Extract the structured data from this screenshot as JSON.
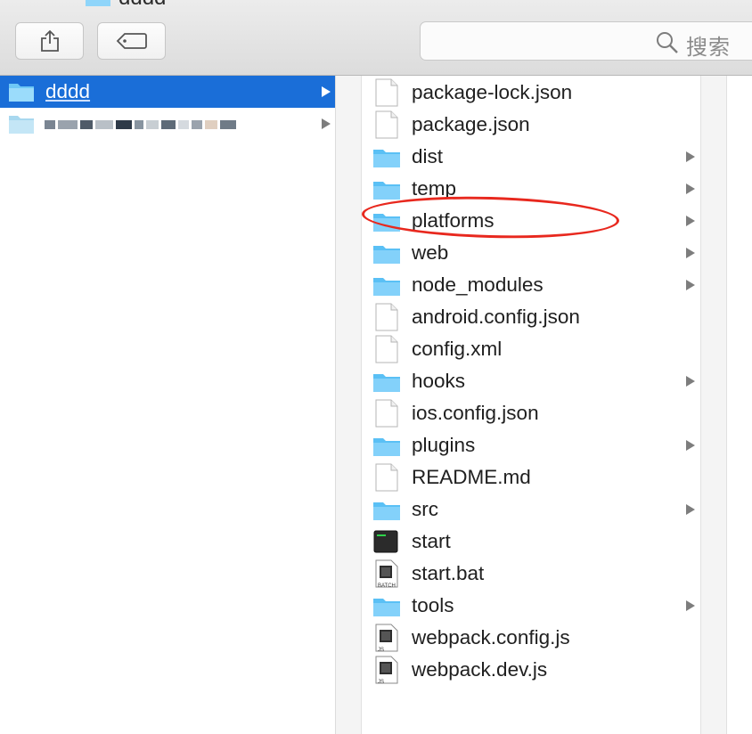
{
  "window": {
    "title": "dddd"
  },
  "toolbar": {
    "share_icon": "share-icon",
    "tag_icon": "tag-icon",
    "search": {
      "placeholder": "搜索",
      "icon": "magnifier-icon"
    }
  },
  "sidebar_column": {
    "items": [
      {
        "label": "dddd",
        "type": "folder",
        "selected": true
      },
      {
        "label": "",
        "type": "folder",
        "selected": false,
        "redacted": true
      }
    ]
  },
  "file_column": {
    "items": [
      {
        "label": "package-lock.json",
        "type": "file"
      },
      {
        "label": "package.json",
        "type": "file"
      },
      {
        "label": "dist",
        "type": "folder"
      },
      {
        "label": "temp",
        "type": "folder"
      },
      {
        "label": "platforms",
        "type": "folder",
        "highlighted": true
      },
      {
        "label": "web",
        "type": "folder"
      },
      {
        "label": "node_modules",
        "type": "folder"
      },
      {
        "label": "android.config.json",
        "type": "file"
      },
      {
        "label": "config.xml",
        "type": "file"
      },
      {
        "label": "hooks",
        "type": "folder"
      },
      {
        "label": "ios.config.json",
        "type": "file"
      },
      {
        "label": "plugins",
        "type": "folder"
      },
      {
        "label": "README.md",
        "type": "file"
      },
      {
        "label": "src",
        "type": "folder"
      },
      {
        "label": "start",
        "type": "exec"
      },
      {
        "label": "start.bat",
        "type": "batch",
        "badge": "BATCH"
      },
      {
        "label": "tools",
        "type": "folder"
      },
      {
        "label": "webpack.config.js",
        "type": "script",
        "badge": "JS"
      },
      {
        "label": "webpack.dev.js",
        "type": "script",
        "badge": "JS"
      }
    ]
  },
  "colors": {
    "selection": "#1a6ed8",
    "folder": "#5ac0f5",
    "annotation": "#e8281e"
  }
}
